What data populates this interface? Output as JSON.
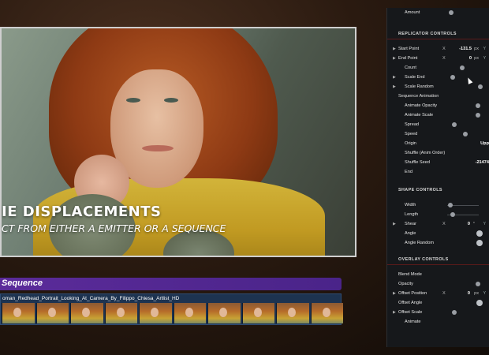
{
  "viewer": {
    "overlay_title": "IE DISPLACEMENTS",
    "overlay_subtitle": "CT FROM EITHER A EMITTER OR A SEQUENCE"
  },
  "sequence": {
    "bar_label": "Sequence",
    "strip_name": "oman_Redhead_Portrait_Looking_At_Camera_By_Filippo_Chiesa_Artlist_HD",
    "thumb_count": 10
  },
  "panel": {
    "amount_label": "Amount",
    "replicator_title": "REPLICATOR CONTROLS",
    "start_point": {
      "label": "Start Point",
      "axis": "X",
      "value": "-131.5",
      "unit": "px",
      "y": "Y"
    },
    "end_point": {
      "label": "End Point",
      "axis": "X",
      "value": "0",
      "unit": "px",
      "y": "Y"
    },
    "count_label": "Count",
    "scale_end_label": "Scale End",
    "scale_random_label": "Scale Random",
    "seq_anim_title": "Sequence Animation",
    "animate_opacity_label": "Animate Opacity",
    "animate_scale_label": "Animate Scale",
    "spread_label": "Spread",
    "speed_label": "Speed",
    "origin_label": "Origin",
    "origin_value": "Upp",
    "shuffle_label": "Shuffle (Anim Order)",
    "shuffle_seed_label": "Shuffle Seed",
    "shuffle_seed_value": "-21474",
    "end_label": "End",
    "shape_title": "SHAPE CONTROLS",
    "width_label": "Width",
    "length_label": "Length",
    "shear": {
      "label": "Shear",
      "axis": "X",
      "value": "0",
      "unit": "°",
      "y": "Y"
    },
    "angle_label": "Angle",
    "angle_random_label": "Angle Random",
    "overlay_title": "OVERLAY CONTROLS",
    "blend_mode_label": "Blend Mode",
    "opacity_label": "Opacity",
    "offset_position": {
      "label": "Offset Position",
      "axis": "X",
      "value": "0",
      "unit": "px",
      "y": "Y"
    },
    "offset_angle_label": "Offset Angle",
    "offset_scale_label": "Offset Scale",
    "animate_label": "Animate"
  }
}
